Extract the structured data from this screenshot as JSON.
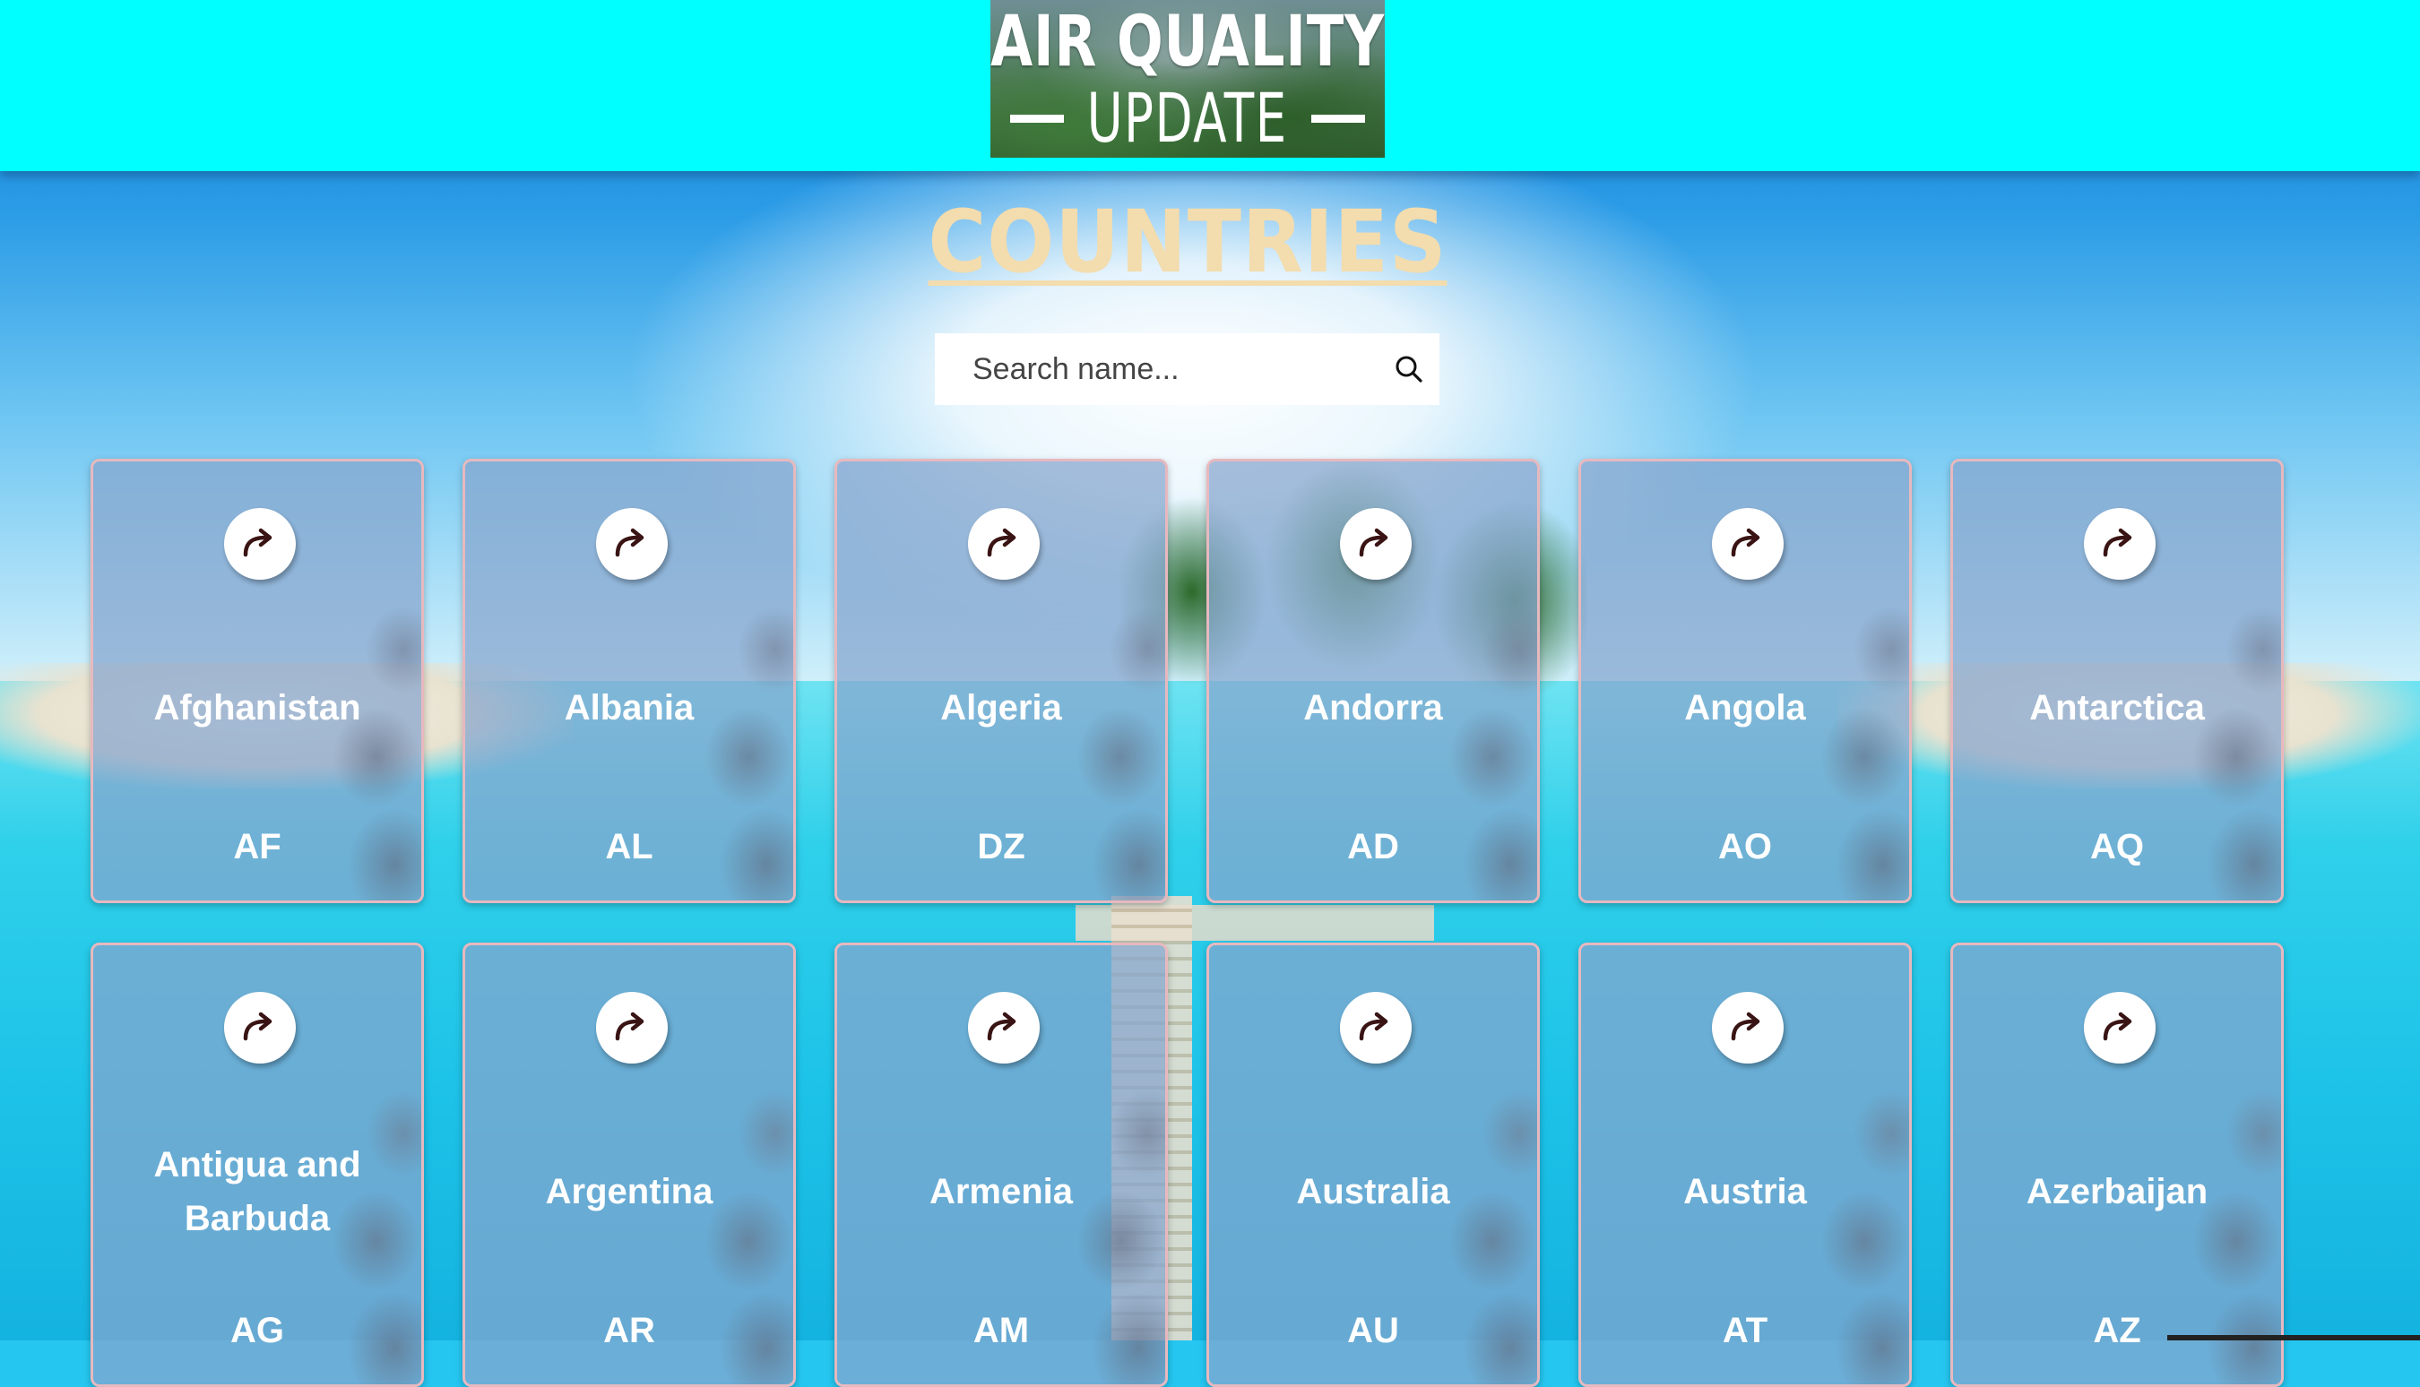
{
  "header": {
    "logo_title": "AIR QUALITY",
    "logo_subtitle": "UPDATE",
    "background_color": "#00ffff"
  },
  "page": {
    "title": "COUNTRIES",
    "title_color": "#f3dcae"
  },
  "search": {
    "placeholder": "Search name...",
    "value": "",
    "icon": "search-icon"
  },
  "cards": {
    "icon": "share-arrow-icon",
    "items": [
      {
        "name": "Afghanistan",
        "code": "AF"
      },
      {
        "name": "Albania",
        "code": "AL"
      },
      {
        "name": "Algeria",
        "code": "DZ"
      },
      {
        "name": "Andorra",
        "code": "AD"
      },
      {
        "name": "Angola",
        "code": "AO"
      },
      {
        "name": "Antarctica",
        "code": "AQ"
      },
      {
        "name": "Antigua and Barbuda",
        "code": "AG"
      },
      {
        "name": "Argentina",
        "code": "AR"
      },
      {
        "name": "Armenia",
        "code": "AM"
      },
      {
        "name": "Australia",
        "code": "AU"
      },
      {
        "name": "Austria",
        "code": "AT"
      },
      {
        "name": "Azerbaijan",
        "code": "AZ"
      }
    ]
  }
}
